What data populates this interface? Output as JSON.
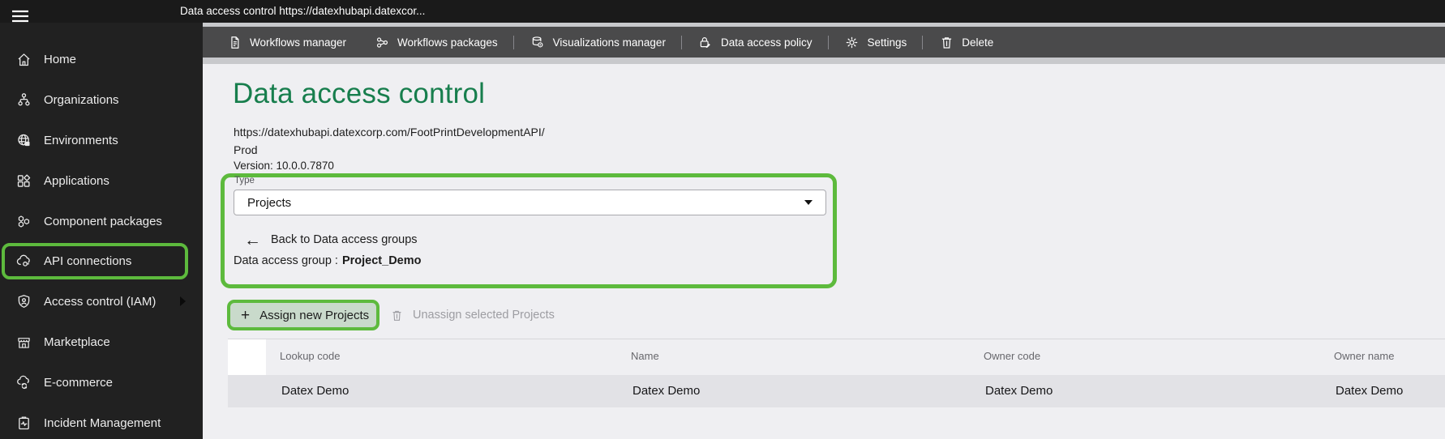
{
  "colors": {
    "annot": "#5dba3d",
    "heading": "#177e4d",
    "titlebar_bg": "#1a1a1a",
    "sidebar_bg": "#212121",
    "toolbar_bg": "#4a4a4b",
    "band_bg": "#c8c9cc",
    "content_bg": "#efeff2",
    "row_bg": "#e2e2e6",
    "assign_fill": "#c9dacb"
  },
  "icons": {
    "plus": "+",
    "back_arrow": "←"
  },
  "title_bar": {
    "title": "Data access control https://datexhubapi.datexcor..."
  },
  "toolbar": {
    "items": [
      {
        "label": "Workflows manager",
        "icon": "document-icon"
      },
      {
        "label": "Workflows packages",
        "icon": "branch-nodes-icon"
      },
      {
        "label": "Visualizations manager",
        "icon": "database-eye-icon"
      },
      {
        "label": "Data access policy",
        "icon": "lock-edit-icon"
      },
      {
        "label": "Settings",
        "icon": "gear-icon"
      },
      {
        "label": "Delete",
        "icon": "trash-icon"
      }
    ]
  },
  "sidebar": {
    "active_item": "API connections",
    "items": [
      {
        "label": "Home",
        "icon": "home-icon"
      },
      {
        "label": "Organizations",
        "icon": "org-chart-icon"
      },
      {
        "label": "Environments",
        "icon": "globe-icon"
      },
      {
        "label": "Applications",
        "icon": "app-grid-icon"
      },
      {
        "label": "Component packages",
        "icon": "hexagons-icon"
      },
      {
        "label": "API connections",
        "icon": "cloud-link-icon"
      },
      {
        "label": "Access control (IAM)",
        "icon": "shield-user-icon"
      },
      {
        "label": "Marketplace",
        "icon": "storefront-icon"
      },
      {
        "label": "E-commerce",
        "icon": "cloud-sync-icon"
      },
      {
        "label": "Incident Management",
        "icon": "clipboard-pulse-icon"
      }
    ]
  },
  "main": {
    "heading": "Data access control",
    "url": "https://datexhubapi.datexcorp.com/FootPrintDevelopmentAPI/",
    "environment": "Prod",
    "version": "Version: 10.0.0.7870",
    "type_field": {
      "label": "Type",
      "value": "Projects"
    },
    "back_link": "Back to Data access groups",
    "group_label": "Data access group :",
    "group_value": "Project_Demo",
    "actions": {
      "assign": "Assign new Projects",
      "unassign": "Unassign selected Projects"
    },
    "table": {
      "columns": [
        "Lookup code",
        "Name",
        "Owner code",
        "Owner name"
      ],
      "rows": [
        [
          "Datex Demo",
          "Datex Demo",
          "Datex Demo",
          "Datex Demo"
        ]
      ]
    }
  }
}
